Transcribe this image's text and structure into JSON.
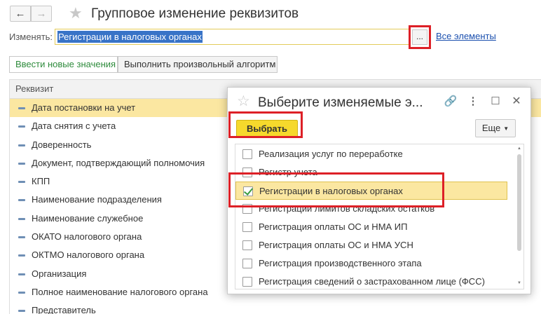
{
  "window": {
    "title": "Групповое изменение реквизитов",
    "back_icon": "←",
    "forward_icon": "→",
    "favorite_icon": "★"
  },
  "edit_row": {
    "label": "Изменять:",
    "value": "Регистрации в налоговых органах",
    "choose_button": "...",
    "all_elements_link": "Все элементы"
  },
  "tabs": [
    {
      "label": "Ввести новые значения"
    },
    {
      "label": "Выполнить произвольный алгоритм"
    }
  ],
  "attributes_table": {
    "header": "Реквизит",
    "rows": [
      "Дата постановки на учет",
      "Дата снятия с учета",
      "Доверенность",
      "Документ, подтверждающий полномочия",
      "КПП",
      "Наименование подразделения",
      "Наименование служебное",
      "ОКАТО налогового органа",
      "ОКТМО налогового органа",
      "Организация",
      "Полное наименование налогового органа",
      "Представитель"
    ]
  },
  "dialog": {
    "title": "Выберите изменяемые э...",
    "star_icon": "☆",
    "link_icon": "🔗",
    "more_icon": "⋮",
    "maximize_icon": "☐",
    "close_icon": "✕",
    "choose_button": "Выбрать",
    "more_button": "Еще",
    "more_caret": "▼",
    "items": [
      {
        "label": "Реализация услуг по переработке",
        "checked": false
      },
      {
        "label": "Регистр учета",
        "checked": false
      },
      {
        "label": "Регистрации в налоговых органах",
        "checked": true
      },
      {
        "label": "Регистрации лимитов складских остатков",
        "checked": false
      },
      {
        "label": "Регистрация оплаты ОС и НМА ИП",
        "checked": false
      },
      {
        "label": "Регистрация оплаты ОС и НМА УСН",
        "checked": false
      },
      {
        "label": "Регистрация производственного этапа",
        "checked": false
      },
      {
        "label": "Регистрация сведений о застрахованном лице (ФСС)",
        "checked": false
      }
    ]
  },
  "colors": {
    "highlight_row": "#fbe7a1",
    "primary_button": "#f6d92c",
    "annotation_red": "#dd2027",
    "link": "#1a4fae",
    "selection": "#3873c7"
  }
}
